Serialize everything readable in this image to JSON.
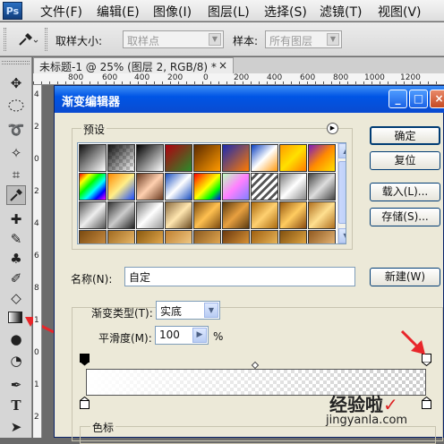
{
  "app": {
    "logo": "Ps"
  },
  "menu": [
    "文件(F)",
    "编辑(E)",
    "图像(I)",
    "图层(L)",
    "选择(S)",
    "滤镜(T)",
    "视图(V)"
  ],
  "options_bar": {
    "sample_size_label": "取样大小:",
    "sample_size_value": "取样点",
    "sample_label": "样本:",
    "sample_value": "所有图层"
  },
  "document_tab": {
    "title": "未标题-1 @ 25% (图层 2, RGB/8) *",
    "close": "×"
  },
  "ruler": {
    "h": [
      "800",
      "600",
      "400",
      "200",
      "0",
      "200",
      "400",
      "600",
      "800",
      "1000",
      "1200"
    ],
    "v": [
      "4",
      "2",
      "0",
      "2",
      "4",
      "6",
      "8",
      "1",
      "0",
      "1",
      "2"
    ]
  },
  "dialog": {
    "title": "渐变编辑器",
    "presets_label": "预设",
    "buttons": {
      "ok": "确定",
      "reset": "复位",
      "load": "载入(L)...",
      "save": "存储(S)...",
      "new": "新建(W)"
    },
    "name_label": "名称(N):",
    "name_value": "自定",
    "gradient_type_label": "渐变类型(T):",
    "gradient_type_value": "实底",
    "smoothness_label": "平滑度(M):",
    "smoothness_value": "100",
    "smoothness_unit": "%",
    "color_stops_label": "色标"
  },
  "watermark": {
    "main": "经验啦",
    "check": "✓",
    "url": "jingyanla.com"
  },
  "colors": {
    "accent_title": "#0055e5",
    "annotation_red": "#e8262a"
  }
}
